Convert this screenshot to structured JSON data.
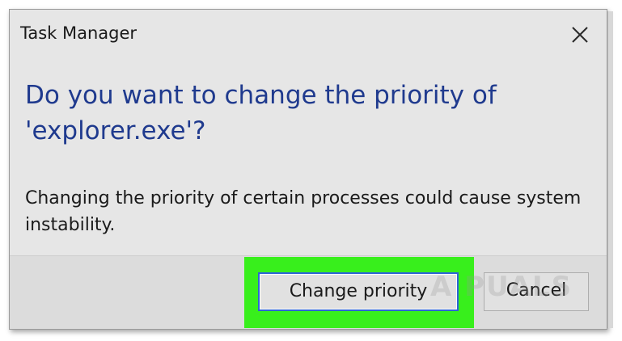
{
  "dialog": {
    "title": "Task Manager",
    "close_icon": "close-icon",
    "main_instruction": "Do you want to change the priority of 'explorer.exe'?",
    "content": "Changing the priority of certain processes could cause system instability.",
    "buttons": {
      "primary_label": "Change priority",
      "secondary_label": "Cancel"
    },
    "highlight_color": "#38ef1c",
    "instruction_color": "#1f3a8e",
    "focus_border_color": "#2d63d6"
  },
  "watermark": "A PUALS"
}
